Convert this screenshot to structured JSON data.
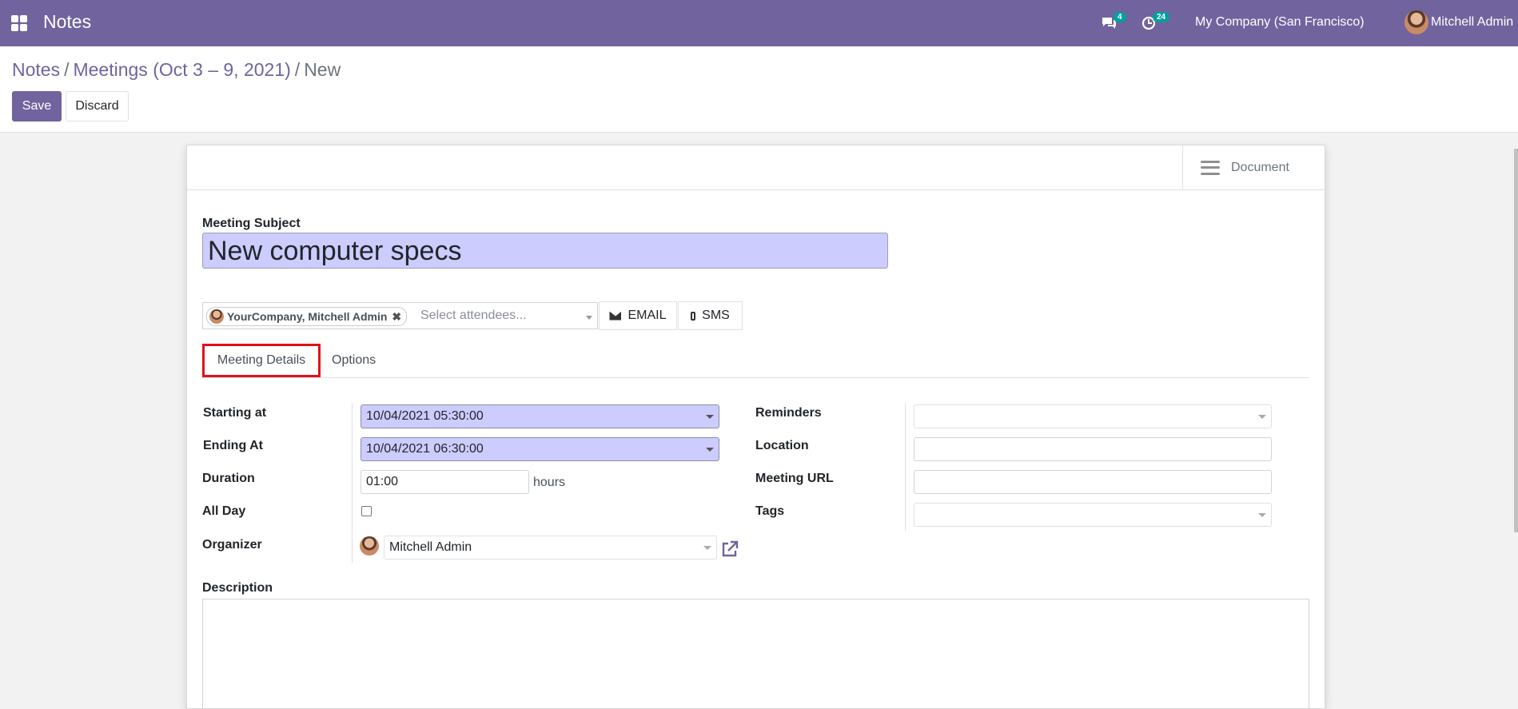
{
  "topbar": {
    "app_name": "Notes",
    "messages_count": "4",
    "activities_count": "24",
    "company": "My Company (San Francisco)",
    "user_name": "Mitchell Admin"
  },
  "breadcrumb": {
    "root": "Notes",
    "parent": "Meetings (Oct 3 – 9, 2021)",
    "current": "New"
  },
  "actions": {
    "save": "Save",
    "discard": "Discard"
  },
  "sheet": {
    "document_label": "Document",
    "subject_label": "Meeting Subject",
    "subject_value": "New computer specs",
    "attendee_tag": "YourCompany, Mitchell Admin",
    "attendee_placeholder": "Select attendees...",
    "email_label": "EMAIL",
    "sms_label": "SMS",
    "tabs": [
      "Meeting Details",
      "Options"
    ],
    "left_fields": {
      "starting_label": "Starting at",
      "starting_value": "10/04/2021 05:30:00",
      "ending_label": "Ending At",
      "ending_value": "10/04/2021 06:30:00",
      "duration_label": "Duration",
      "duration_value": "01:00",
      "duration_unit": "hours",
      "allday_label": "All Day",
      "organizer_label": "Organizer",
      "organizer_value": "Mitchell Admin"
    },
    "right_fields": {
      "reminders_label": "Reminders",
      "location_label": "Location",
      "url_label": "Meeting URL",
      "tags_label": "Tags"
    },
    "description_label": "Description"
  },
  "colors": {
    "brand": "#71639e",
    "highlight_field": "#ccccff",
    "tab_outline": "#e0111b"
  }
}
